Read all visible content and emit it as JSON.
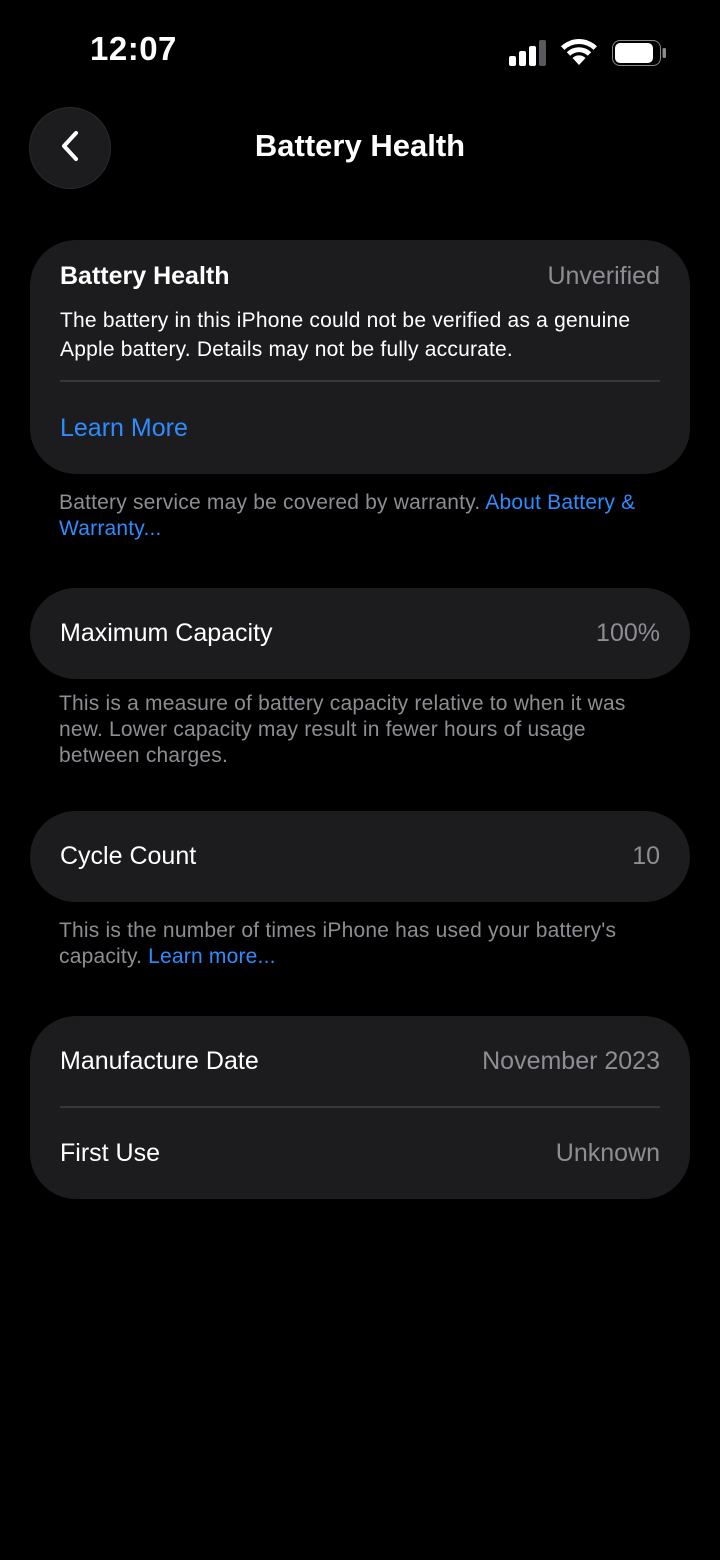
{
  "status_bar": {
    "time": "12:07",
    "signal_icon": "cellular-signal-icon",
    "wifi_icon": "wifi-icon",
    "battery_icon": "battery-icon"
  },
  "header": {
    "back_icon": "chevron-left-icon",
    "title": "Battery Health"
  },
  "health_card": {
    "label": "Battery Health",
    "value": "Unverified",
    "description": "The battery in this iPhone could not be verified as a genuine Apple battery. Details may not be fully accurate.",
    "link": "Learn More"
  },
  "warranty_note": {
    "text": "Battery service may be covered by warranty. ",
    "link": "About Battery & Warranty..."
  },
  "capacity_card": {
    "label": "Maximum Capacity",
    "value": "100%"
  },
  "capacity_note": {
    "text": "This is a measure of battery capacity relative to when it was new. Lower capacity may result in fewer hours of usage between charges."
  },
  "cycle_card": {
    "label": "Cycle Count",
    "value": "10"
  },
  "cycle_note": {
    "text": "This is the number of times iPhone has used your battery's capacity. ",
    "link": "Learn more..."
  },
  "dates_card": {
    "manufacture_label": "Manufacture Date",
    "manufacture_value": "November 2023",
    "first_use_label": "First Use",
    "first_use_value": "Unknown"
  },
  "colors": {
    "background": "#000000",
    "card": "#1c1c1e",
    "secondary_text": "#8d8d93",
    "link": "#2e8cff",
    "separator": "#38383a"
  }
}
